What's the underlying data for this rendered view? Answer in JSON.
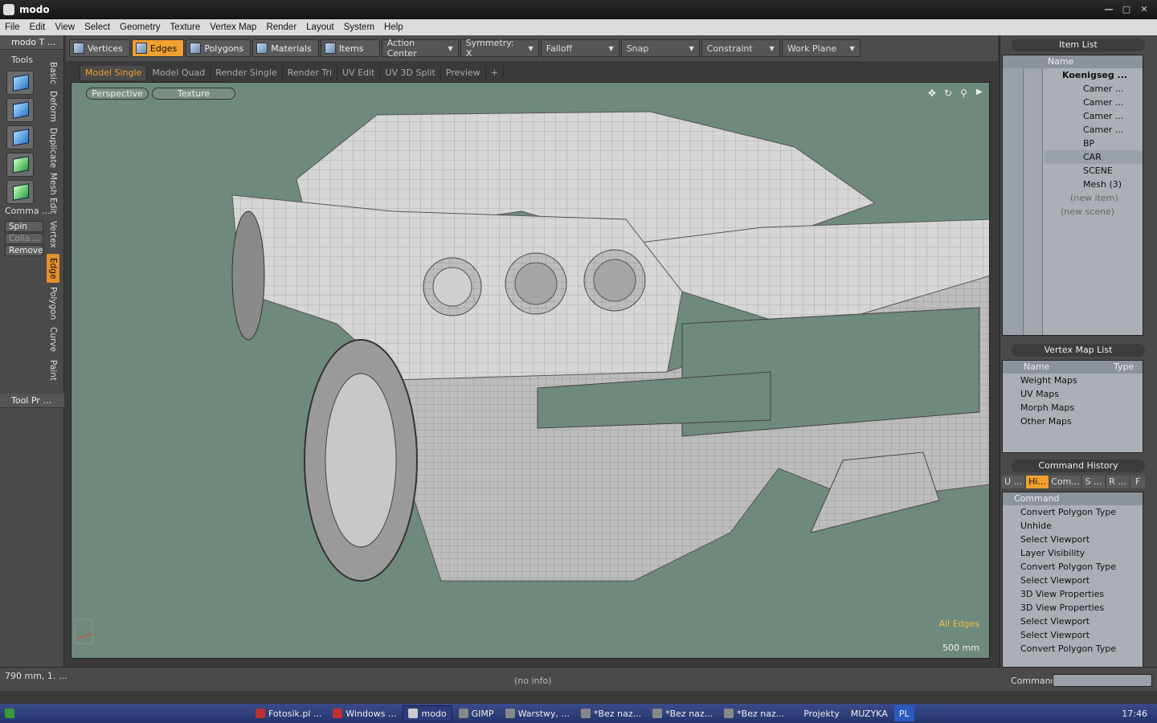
{
  "window": {
    "title": "modo"
  },
  "menu": [
    "File",
    "Edit",
    "View",
    "Select",
    "Geometry",
    "Texture",
    "Vertex Map",
    "Render",
    "Layout",
    "System",
    "Help"
  ],
  "left_panel": {
    "header": "modo T ...",
    "tools_label": "Tools",
    "command_label": "Comma ...",
    "buttons": [
      "Spin",
      "Colla ...",
      "Remove"
    ],
    "tool_props": "Tool Pr ...",
    "vtabs": [
      "Basic",
      "Deform",
      "Duplicate",
      "Mesh Edit",
      "Vertex",
      "Edge",
      "Polygon",
      "Curve",
      "Paint"
    ]
  },
  "toolbar": {
    "modes": [
      "Vertices",
      "Edges",
      "Polygons",
      "Materials",
      "Items"
    ],
    "active_mode": "Edges",
    "dropdowns": [
      "Action Center",
      "Symmetry: X",
      "Falloff",
      "Snap",
      "Constraint",
      "Work Plane"
    ]
  },
  "viewport_tabs": [
    "Model Single",
    "Model Quad",
    "Render Single",
    "Render Tri",
    "UV Edit",
    "UV 3D Split",
    "Preview",
    "+"
  ],
  "viewport": {
    "view_mode": "Perspective",
    "shade_mode": "Texture",
    "info_edges": "All Edges",
    "scale": "500 mm"
  },
  "item_list": {
    "title": "Item List",
    "col_name": "Name",
    "items": [
      {
        "label": "Koenigseg ...",
        "bold": true
      },
      {
        "label": "Camer ..."
      },
      {
        "label": "Camer ..."
      },
      {
        "label": "Camer ..."
      },
      {
        "label": "Camer ..."
      },
      {
        "label": "BP"
      },
      {
        "label": "CAR"
      },
      {
        "label": "SCENE"
      },
      {
        "label": "Mesh (3)"
      },
      {
        "label": "(new item)"
      },
      {
        "label": "(new scene)"
      }
    ]
  },
  "vertex_map_list": {
    "title": "Vertex Map List",
    "col_name": "Name",
    "col_type": "Type",
    "items": [
      "Weight Maps",
      "UV Maps",
      "Morph Maps",
      "Other Maps"
    ]
  },
  "command_history": {
    "title": "Command History",
    "tabs": [
      "U ...",
      "Hi...",
      "Com...",
      "S ...",
      "R ...",
      "F"
    ],
    "col": "Command",
    "items": [
      "Convert Polygon Type",
      "Unhide",
      "Select Viewport",
      "Layer Visibility",
      "Convert Polygon Type",
      "Select Viewport",
      "3D View Properties",
      "3D View Properties",
      "Select Viewport",
      "Select Viewport",
      "Convert Polygon Type"
    ]
  },
  "status": {
    "coords": "790 mm, 1. ...",
    "info": "(no info)",
    "command_label": "Command"
  },
  "taskbar": {
    "items": [
      "Fotosik.pl ...",
      "Windows ...",
      "modo",
      "GIMP",
      "Warstwy, ...",
      "*Bez naz...",
      "*Bez naz...",
      "*Bez naz..."
    ],
    "active": "modo",
    "tray": [
      "Projekty",
      "MUZYKA",
      "PL"
    ],
    "time": "17:46"
  },
  "colors": {
    "accent": "#f0a030",
    "viewport_bg": "#6e8a7c"
  }
}
